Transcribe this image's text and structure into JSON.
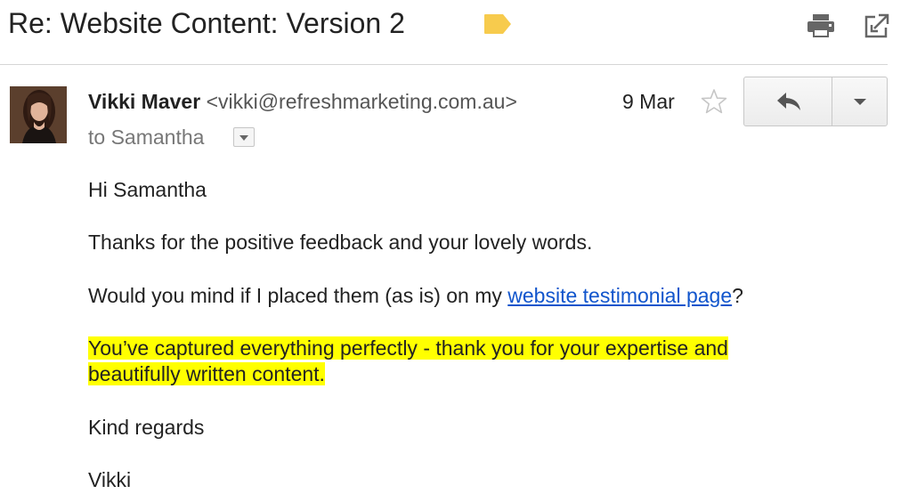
{
  "thread": {
    "subject": "Re: Website Content: Version 2",
    "label_color": "#f7cb4d",
    "print_icon": "print-icon",
    "new_window_icon": "open-in-new-window-icon"
  },
  "message": {
    "sender_name": "Vikki Maver",
    "sender_email": "<vikki@refreshmarketing.com.au>",
    "recipient": "to Samantha",
    "date": "9 Mar",
    "starred": false,
    "reply_icon": "reply-icon",
    "more_icon": "chevron-down-icon"
  },
  "body": {
    "greeting": "Hi Samantha",
    "para1": "Thanks for the positive feedback and your lovely words.",
    "para2_before": "Would you mind if I placed them (as is) on my ",
    "para2_link": "website testimonial page",
    "para2_after": "?",
    "highlight_line1": "You’ve captured everything perfectly - thank you for your expertise and",
    "highlight_line2": "beautifully written content. ",
    "signoff": "Kind regards",
    "signature": "Vikki",
    "highlight_color": "#ffff00",
    "link_color": "#1155cc"
  }
}
